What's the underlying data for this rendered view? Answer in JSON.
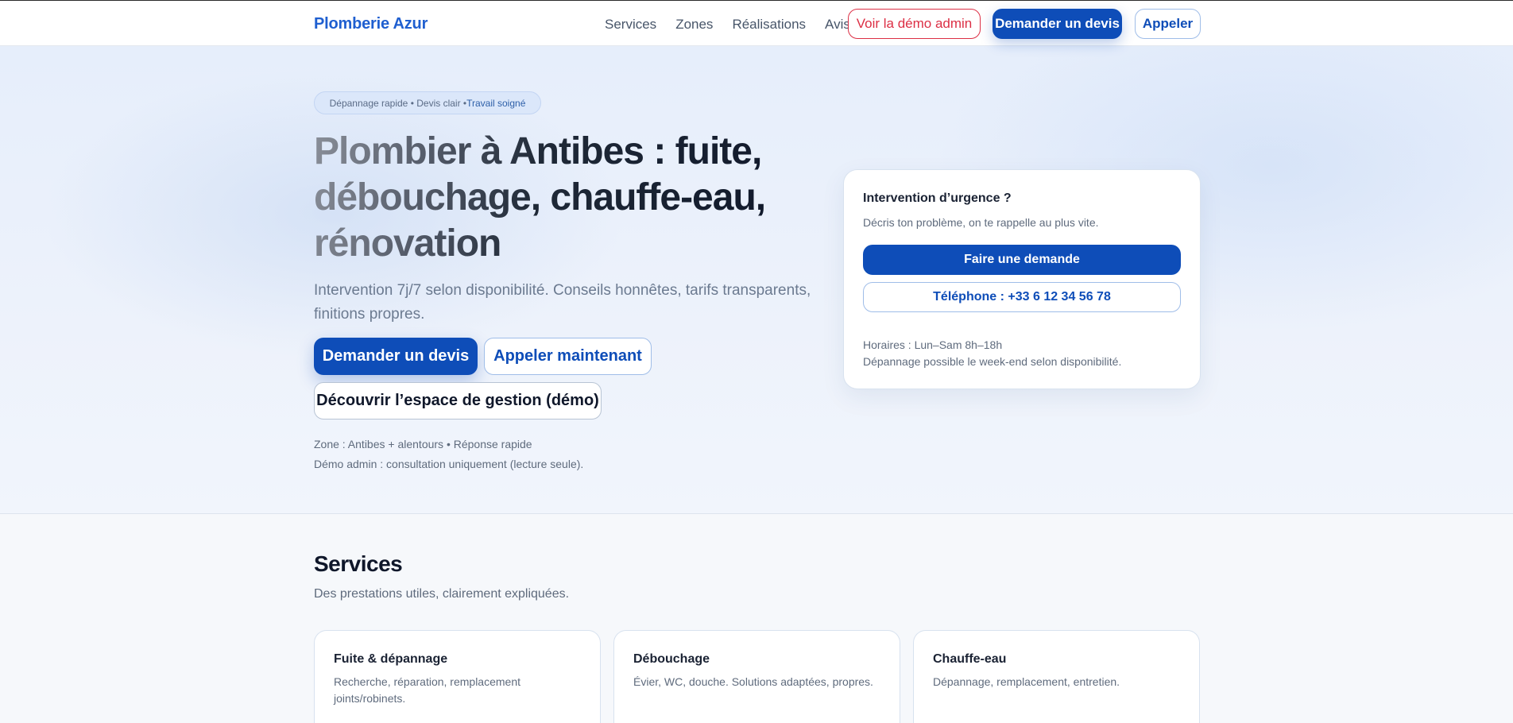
{
  "header": {
    "brand": "Plomberie Azur",
    "nav": [
      "Services",
      "Zones",
      "Réalisations",
      "Avis"
    ],
    "demo_button": "Voir la démo admin",
    "devis_button": "Demander un devis",
    "call_button": "Appeler"
  },
  "hero": {
    "pill_part1": "Dépannage rapide • Devis clair • ",
    "pill_part2": "Travail soigné",
    "title": "Plombier à Antibes : fuite, débouchage, chauffe-eau, rénovation",
    "subtitle": "Intervention 7j/7 selon disponibilité. Conseils honnêtes, tarifs transparents, finitions propres.",
    "btn_devis": "Demander un devis",
    "btn_call": "Appeler maintenant",
    "btn_demo": "Découvrir l’espace de gestion (démo)",
    "meta_line1": "Zone : Antibes + alentours • Réponse rapide",
    "meta_line2": "Démo admin : consultation uniquement (lecture seule)."
  },
  "urgent_card": {
    "title": "Intervention d’urgence ?",
    "description": "Décris ton problème, on te rappelle au plus vite.",
    "btn_request": "Faire une demande",
    "btn_phone": "Téléphone : +33 6 12 34 56 78",
    "hours": "Horaires : Lun–Sam 8h–18h",
    "weekend": "Dépannage possible le week-end selon disponibilité."
  },
  "services": {
    "title": "Services",
    "subtitle": "Des prestations utiles, clairement expliquées.",
    "items": [
      {
        "title": "Fuite & dépannage",
        "description": "Recherche, réparation, remplacement joints/robinets."
      },
      {
        "title": "Débouchage",
        "description": "Évier, WC, douche. Solutions adaptées, propres."
      },
      {
        "title": "Chauffe-eau",
        "description": "Dépannage, remplacement, entretien."
      }
    ]
  }
}
